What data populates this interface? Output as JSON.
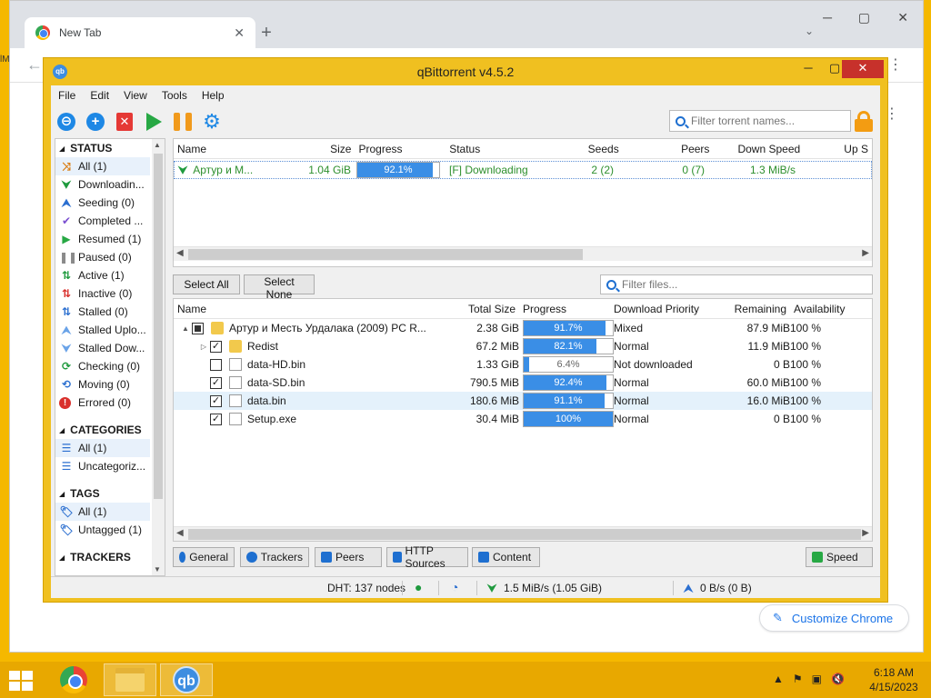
{
  "chrome": {
    "tab_title": "New Tab",
    "customize_label": "Customize Chrome",
    "edge_label": "lM"
  },
  "window": {
    "title": "qBittorrent v4.5.2"
  },
  "menu": [
    "File",
    "Edit",
    "View",
    "Tools",
    "Help"
  ],
  "toolbar": {
    "search_placeholder": "Filter torrent names..."
  },
  "sidebar": {
    "status_header": "STATUS",
    "status": [
      {
        "icon": "all",
        "label": "All (1)"
      },
      {
        "icon": "downloading",
        "label": "Downloadin..."
      },
      {
        "icon": "seeding",
        "label": "Seeding (0)"
      },
      {
        "icon": "completed",
        "label": "Completed ..."
      },
      {
        "icon": "resumed",
        "label": "Resumed (1)"
      },
      {
        "icon": "paused",
        "label": "Paused (0)"
      },
      {
        "icon": "active",
        "label": "Active (1)"
      },
      {
        "icon": "inactive",
        "label": "Inactive (0)"
      },
      {
        "icon": "stalled",
        "label": "Stalled (0)"
      },
      {
        "icon": "stalled-up",
        "label": "Stalled Uplo..."
      },
      {
        "icon": "stalled-down",
        "label": "Stalled Dow..."
      },
      {
        "icon": "checking",
        "label": "Checking (0)"
      },
      {
        "icon": "moving",
        "label": "Moving (0)"
      },
      {
        "icon": "errored",
        "label": "Errored (0)"
      }
    ],
    "categories_header": "CATEGORIES",
    "categories": [
      "All (1)",
      "Uncategoriz..."
    ],
    "tags_header": "TAGS",
    "tags": [
      "All (1)",
      "Untagged (1)"
    ],
    "trackers_header": "TRACKERS"
  },
  "torrent_table": {
    "headers": [
      "Name",
      "Size",
      "Progress",
      "Status",
      "Seeds",
      "Peers",
      "Down Speed",
      "Up S"
    ],
    "rows": [
      {
        "name": "Артур и М...",
        "size": "1.04 GiB",
        "progress": 92.1,
        "progress_label": "92.1%",
        "status": "[F] Downloading",
        "seeds": "2 (2)",
        "peers": "0 (7)",
        "down_speed": "1.3 MiB/s"
      }
    ]
  },
  "file_buttons": {
    "select_all": "Select All",
    "select_none": "Select None",
    "filter_placeholder": "Filter files..."
  },
  "file_table": {
    "headers": [
      "Name",
      "Total Size",
      "Progress",
      "Download Priority",
      "Remaining",
      "Availability"
    ],
    "rows": [
      {
        "name": "Артур и Месть Урдалака  (2009) PC  R...",
        "size": "2.38 GiB",
        "progress": 91.7,
        "progress_label": "91.7%",
        "priority": "Mixed",
        "remaining": "87.9 MiB",
        "availability": "100 %",
        "checked": "partial",
        "type": "folder",
        "level": 0,
        "expander": "▲"
      },
      {
        "name": "Redist",
        "size": "67.2 MiB",
        "progress": 82.1,
        "progress_label": "82.1%",
        "priority": "Normal",
        "remaining": "11.9 MiB",
        "availability": "100 %",
        "checked": "yes",
        "type": "folder",
        "level": 1,
        "expander": "▷"
      },
      {
        "name": "data-HD.bin",
        "size": "1.33 GiB",
        "progress": 6.4,
        "progress_label": "6.4%",
        "priority": "Not downloaded",
        "remaining": "0 B",
        "availability": "100 %",
        "checked": "no",
        "type": "file",
        "level": 1,
        "expander": ""
      },
      {
        "name": "data-SD.bin",
        "size": "790.5 MiB",
        "progress": 92.4,
        "progress_label": "92.4%",
        "priority": "Normal",
        "remaining": "60.0 MiB",
        "availability": "100 %",
        "checked": "yes",
        "type": "file",
        "level": 1,
        "expander": ""
      },
      {
        "name": "data.bin",
        "size": "180.6 MiB",
        "progress": 91.1,
        "progress_label": "91.1%",
        "priority": "Normal",
        "remaining": "16.0 MiB",
        "availability": "100 %",
        "checked": "yes",
        "type": "file",
        "level": 1,
        "expander": ""
      },
      {
        "name": "Setup.exe",
        "size": "30.4 MiB",
        "progress": 100,
        "progress_label": "100%",
        "priority": "Normal",
        "remaining": "0 B",
        "availability": "100 %",
        "checked": "yes",
        "type": "file",
        "level": 1,
        "expander": ""
      }
    ]
  },
  "bottom_tabs": [
    "General",
    "Trackers",
    "Peers",
    "HTTP Sources",
    "Content"
  ],
  "speed_button": "Speed",
  "statusbar": {
    "dht": "DHT: 137 nodes",
    "download": "1.5 MiB/s (1.05 GiB)",
    "upload": "0 B/s (0 B)"
  },
  "taskbar": {
    "time": "6:18 AM",
    "date": "4/15/2023"
  },
  "colors": {
    "accent": "#3a8ee6",
    "desktop": "#f5b800",
    "window_frame": "#f0c020",
    "close_button": "#c7312b",
    "downloading_text": "#2d8f2d"
  }
}
